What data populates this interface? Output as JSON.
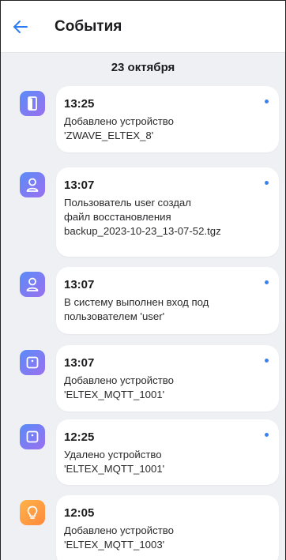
{
  "header": {
    "title": "События"
  },
  "date_header": "23 октября",
  "colors": {
    "accent": "#3a82f0",
    "icon_purple": "#7a7cf3",
    "icon_orange": "#ff9f43"
  },
  "events": [
    {
      "time": "13:25",
      "lines": [
        "Добавлено устройство",
        "'ZWAVE_ELTEX_8'"
      ],
      "icon": "door-icon",
      "unread": true
    },
    {
      "time": "13:07",
      "lines": [
        "Пользователь user создал",
        "файл восстановления",
        "backup_2023-10-23_13-07-52.tgz"
      ],
      "icon": "user-icon",
      "unread": true
    },
    {
      "time": "13:07",
      "lines": [
        "В систему выполнен вход под",
        "пользователем 'user'"
      ],
      "icon": "user-icon",
      "unread": true
    },
    {
      "time": "13:07",
      "lines": [
        "Добавлено устройство",
        "'ELTEX_MQTT_1001'"
      ],
      "icon": "device-icon",
      "unread": true
    },
    {
      "time": "12:25",
      "lines": [
        "Удалено устройство",
        "'ELTEX_MQTT_1001'"
      ],
      "icon": "device-icon",
      "unread": true
    },
    {
      "time": "12:05",
      "lines": [
        "Добавлено устройство",
        "'ELTEX_MQTT_1003'"
      ],
      "icon": "lightbulb-icon",
      "unread": false
    }
  ]
}
